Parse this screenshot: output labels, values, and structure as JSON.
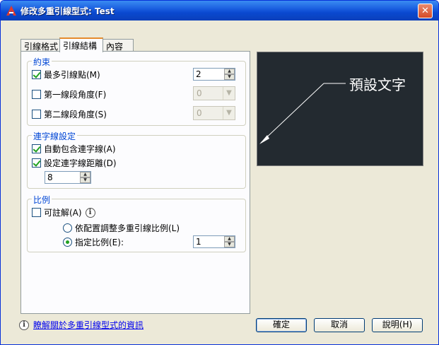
{
  "window": {
    "title": "修改多重引線型式: Test",
    "close_glyph": "✕"
  },
  "tabs": [
    {
      "label": "引線格式",
      "active": false
    },
    {
      "label": "引線結構",
      "active": true
    },
    {
      "label": "內容",
      "active": false
    }
  ],
  "constraints": {
    "legend": "約束",
    "max_points": {
      "label": "最多引線點(M)",
      "checked": true,
      "value": "2"
    },
    "first_angle": {
      "label": "第一線段角度(F)",
      "checked": false,
      "value": "0"
    },
    "second_angle": {
      "label": "第二線段角度(S)",
      "checked": false,
      "value": "0"
    }
  },
  "landing": {
    "legend": "連字線設定",
    "auto_include": {
      "label": "自動包含連字線(A)",
      "checked": true
    },
    "set_distance": {
      "label": "設定連字線距離(D)",
      "checked": true,
      "value": "8"
    }
  },
  "scale": {
    "legend": "比例",
    "annotative": {
      "label": "可註解(A)",
      "checked": false
    },
    "scale_to_layout": {
      "label": "依配置調整多重引線比例(L)",
      "selected": false
    },
    "specify_scale": {
      "label": "指定比例(E):",
      "selected": true,
      "value": "1"
    }
  },
  "preview": {
    "text": "預設文字"
  },
  "footer": {
    "info_link": "瞭解關於多重引線型式的資訊",
    "ok": "確定",
    "cancel": "取消",
    "help": "說明(H)"
  },
  "colors": {
    "titlebar": "#0a49d0",
    "legend": "#0046d5",
    "preview_bg": "#232a30",
    "check": "#21a121"
  }
}
